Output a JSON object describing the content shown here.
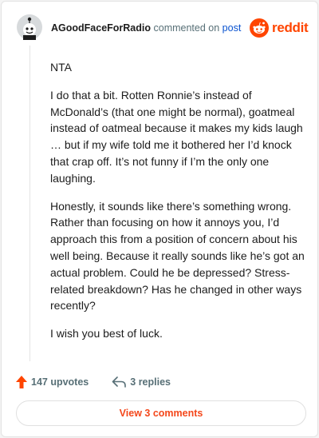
{
  "comment": {
    "author": "AGoodFaceForRadio",
    "action_text": "commented on",
    "post_link": "post",
    "paragraphs": [
      "NTA",
      "I do that a bit. Rotten Ronnie’s instead of McDonald’s (that one might be normal), goatmeal instead of oatmeal because it makes my kids laugh … but if my wife told me it bothered her I’d knock that crap off. It’s not funny if I’m the only one laughing.",
      "Honestly, it sounds like there’s something wrong. Rather than focusing on how it annoys you, I’d approach this from a position of concern about his well being. Because it really sounds like he’s got an actual problem. Could he be depressed? Stress-related breakdown? Has he changed in other ways recently?",
      "I wish you best of luck."
    ]
  },
  "brand": {
    "wordmark": "reddit",
    "color": "#ff4500"
  },
  "actions": {
    "upvotes": "147 upvotes",
    "replies": "3 replies",
    "view_comments": "View 3 comments"
  },
  "icons": [
    "avatar-icon",
    "reddit-logo-icon",
    "upvote-arrow-icon",
    "reply-arrow-icon"
  ]
}
